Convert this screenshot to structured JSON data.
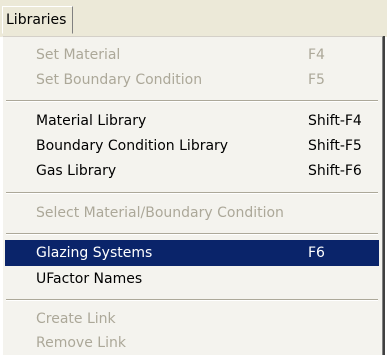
{
  "menubar": {
    "title": "Libraries"
  },
  "menu": {
    "set_material": {
      "label": "Set Material",
      "shortcut": "F4"
    },
    "set_boundary": {
      "label": "Set Boundary Condition",
      "shortcut": "F5"
    },
    "material_library": {
      "label": "Material Library",
      "shortcut": "Shift-F4"
    },
    "boundary_library": {
      "label": "Boundary Condition Library",
      "shortcut": "Shift-F5"
    },
    "gas_library": {
      "label": "Gas Library",
      "shortcut": "Shift-F6"
    },
    "select_material_boundary": {
      "label": "Select Material/Boundary Condition"
    },
    "glazing_systems": {
      "label": "Glazing Systems",
      "shortcut": "F6"
    },
    "ufactor_names": {
      "label": "UFactor Names"
    },
    "create_link": {
      "label": "Create Link"
    },
    "remove_link": {
      "label": "Remove Link"
    }
  },
  "colors": {
    "highlight": "#0a246a",
    "disabled_text": "#aca899",
    "menu_bg": "#f4f3ee",
    "menubar_bg": "#ece9d8"
  }
}
